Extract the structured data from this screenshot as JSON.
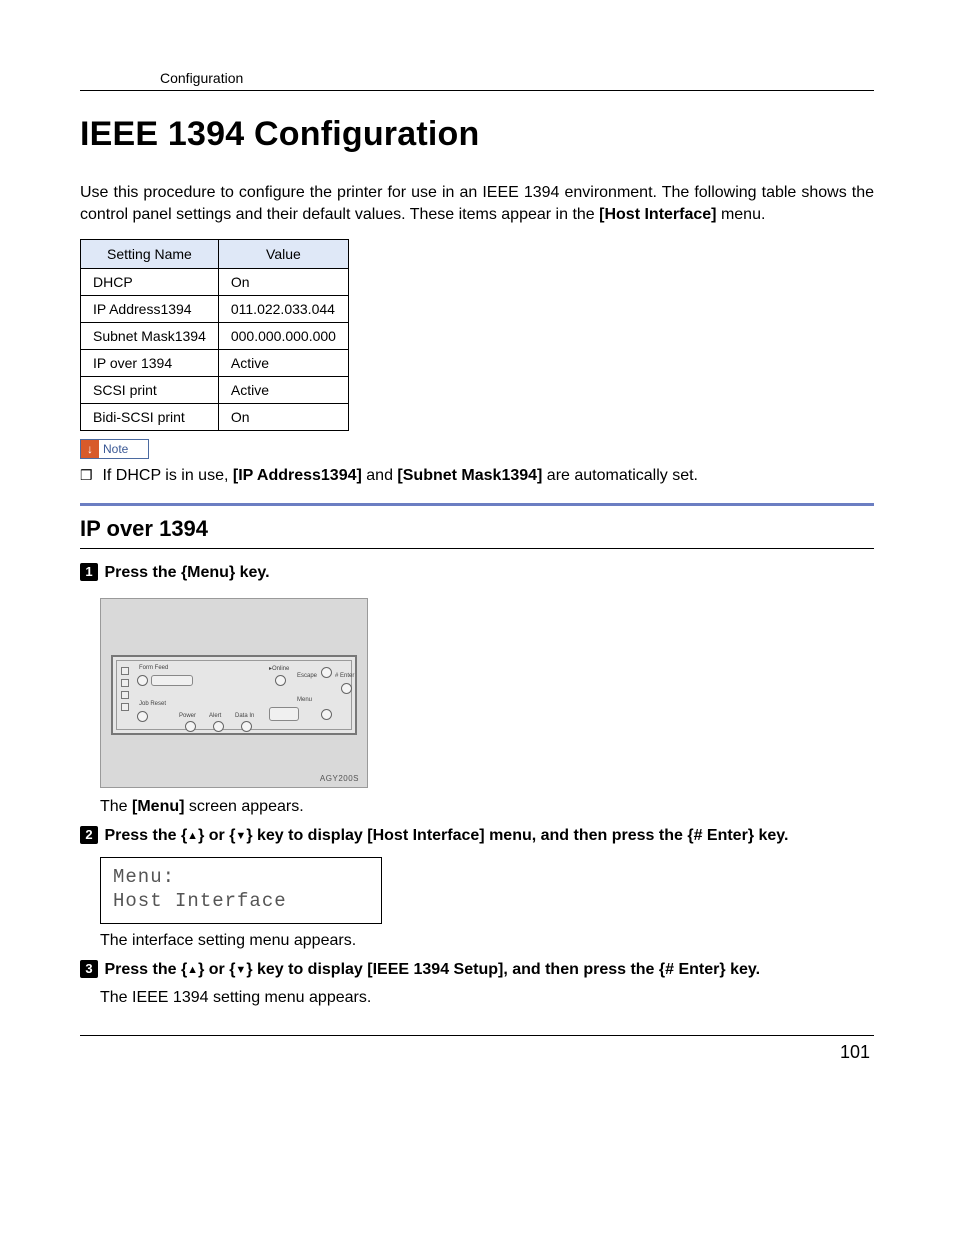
{
  "header": {
    "running": "Configuration"
  },
  "title": "IEEE 1394 Configuration",
  "intro": {
    "line1": "Use this procedure to configure the printer for use in an IEEE 1394 environment. The following table shows the control panel settings and their default values. These items appear in the ",
    "menu_ref": "[Host Interface]",
    "line1_end": " menu."
  },
  "table": {
    "headers": {
      "c1": "Setting Name",
      "c2": "Value"
    },
    "rows": [
      {
        "name": "DHCP",
        "value": "On"
      },
      {
        "name": "IP Address1394",
        "value": "011.022.033.044"
      },
      {
        "name": "Subnet Mask1394",
        "value": "000.000.000.000"
      },
      {
        "name": "IP over 1394",
        "value": "Active"
      },
      {
        "name": "SCSI print",
        "value": "Active"
      },
      {
        "name": "Bidi-SCSI print",
        "value": "On"
      }
    ]
  },
  "note": {
    "label": "Note",
    "text_pre": "If DHCP is in use, ",
    "bold1": "[IP Address1394]",
    "mid": " and ",
    "bold2": "[Subnet Mask1394]",
    "text_post": " are automatically set."
  },
  "section": {
    "title": "IP over 1394"
  },
  "steps": {
    "s1": {
      "num": "1",
      "pre": "Press the ",
      "key_open": "{",
      "key_label": "Menu",
      "key_close": "}",
      "post": " key.",
      "after": "The ",
      "after_bold": "[Menu]",
      "after_end": " screen appears."
    },
    "s2": {
      "num": "2",
      "t1": "Press the ",
      "k1o": "{",
      "k1c": "}",
      "t2": " or ",
      "k2o": "{",
      "k2c": "}",
      "t3": " key to display ",
      "bold1": "[Host Interface]",
      "t4": " menu, and then press the ",
      "k3o": "{",
      "k3": "# Enter",
      "k3c": "}",
      "t5": " key.",
      "lcd_l1": "Menu:",
      "lcd_l2": " Host Interface",
      "after": "The interface setting menu appears."
    },
    "s3": {
      "num": "3",
      "t1": "Press the ",
      "k1o": "{",
      "k1c": "}",
      "t2": " or ",
      "k2o": "{",
      "k2c": "}",
      "t3": " key to display ",
      "bold1": "[IEEE 1394 Setup]",
      "t4": ", and then press the ",
      "k3o": "{",
      "k3": "# Enter",
      "k3c": "}",
      "t5": " key.",
      "after": "The IEEE 1394 setting menu appears."
    }
  },
  "panel": {
    "labels": {
      "form_feed": "Form Feed",
      "job_reset": "Job Reset",
      "power": "Power",
      "alert": "Alert",
      "data_in": "Data In",
      "online": "Online",
      "escape": "Escape",
      "enter": "# Enter",
      "menu": "Menu"
    },
    "caption": "AGY200S"
  },
  "footer": {
    "page": "101"
  }
}
